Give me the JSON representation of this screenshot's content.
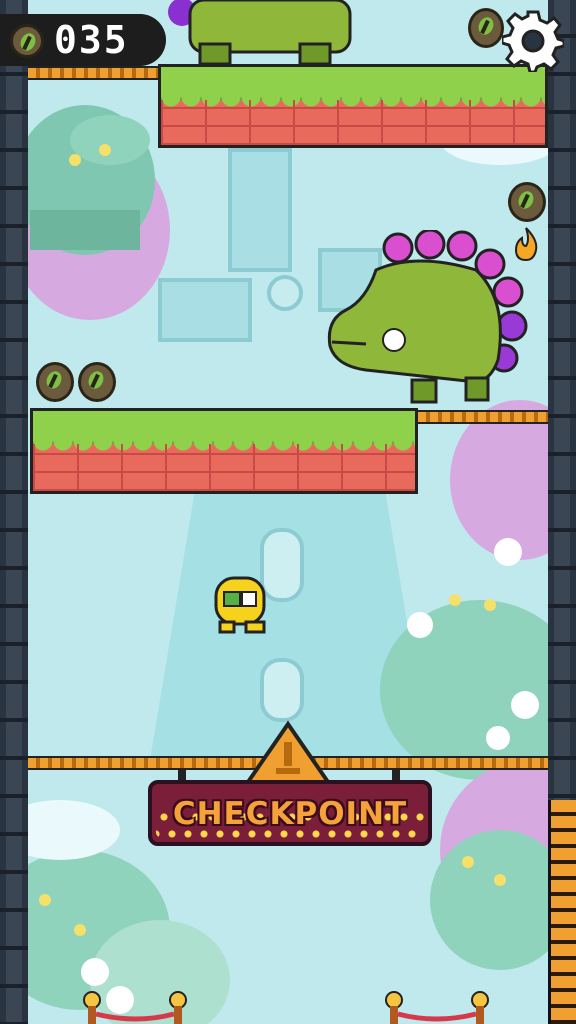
{
  "hud": {
    "score": "035",
    "coin_icon": "coin-icon",
    "settings_icon": "gear-icon"
  },
  "checkpoint": {
    "label": "CHECKPOINT"
  },
  "colors": {
    "sky": "#bfe9ec",
    "grass": "#8fd14a",
    "brick": "#e86a5d",
    "wall": "#2a3340",
    "sign": "#7a1e3a",
    "sign_text": "#f5a23a"
  },
  "pickups": [
    {
      "type": "coin"
    },
    {
      "type": "coin"
    },
    {
      "type": "coin"
    },
    {
      "type": "coin"
    },
    {
      "type": "fire-powerup"
    }
  ],
  "characters": [
    {
      "type": "player-chick"
    },
    {
      "type": "dino-enemy-purple-spikes"
    },
    {
      "type": "dino-enemy-top"
    }
  ]
}
